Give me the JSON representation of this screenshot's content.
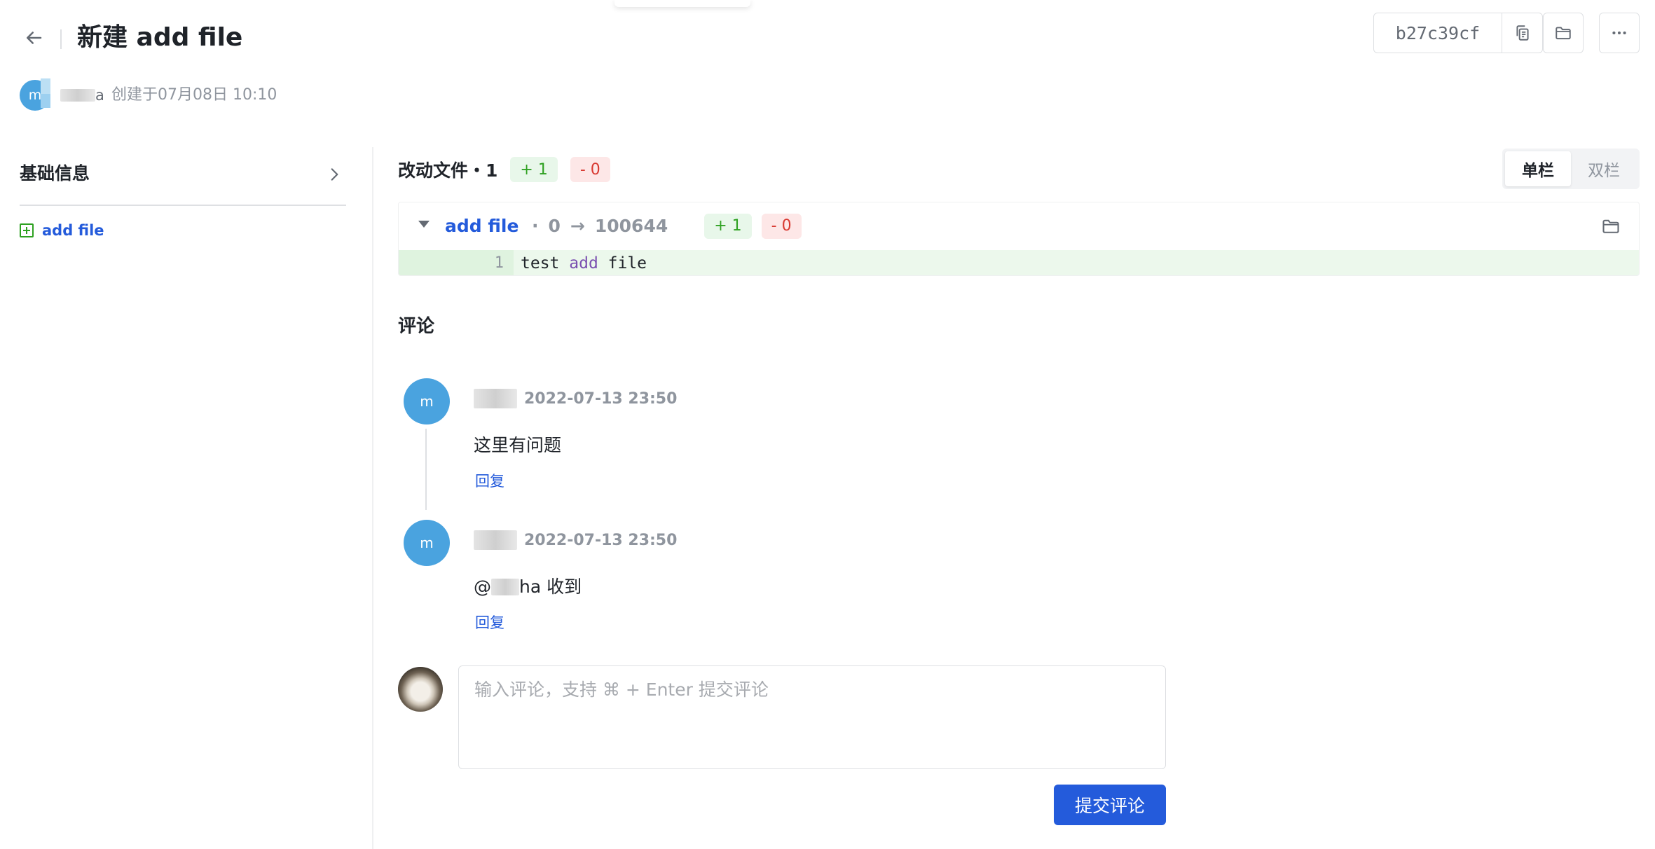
{
  "header": {
    "title": "新建 add file",
    "commit_hash": "b27c39cf",
    "author_name_suffix": "a",
    "created_at": "创建于07月08日 10:10",
    "author_avatar_letter": "m"
  },
  "sidebar": {
    "section_title": "基础信息",
    "files": [
      {
        "name": "add file",
        "status": "added"
      }
    ]
  },
  "changes": {
    "title": "改动文件・1",
    "added": "+ 1",
    "removed": "- 0",
    "view_modes": [
      "单栏",
      "双栏"
    ],
    "active_view": "单栏"
  },
  "diff": {
    "file_name": "add file",
    "sep": "·",
    "old_mode": "0",
    "arrow": "→",
    "new_mode": "100644",
    "added": "+ 1",
    "removed": "- 0",
    "lines": [
      {
        "number": "1",
        "code_a": "test ",
        "code_kw": "add",
        "code_b": " file"
      }
    ]
  },
  "comments": {
    "title": "评论",
    "items": [
      {
        "avatar_letter": "m",
        "time": "2022-07-13 23:50",
        "body": "这里有问题",
        "reply_label": "回复"
      },
      {
        "avatar_letter": "m",
        "time": "2022-07-13 23:50",
        "body_prefix": "@",
        "body_suffix": "ha 收到",
        "reply_label": "回复"
      }
    ],
    "input_placeholder": "输入评论，支持 ⌘ + Enter 提交评论",
    "submit_label": "提交评论"
  },
  "colors": {
    "primary": "#245bdb",
    "add": "#2ea121",
    "remove": "#d83931",
    "avatar": "#4aa3df"
  },
  "icons": [
    "arrow-left-icon",
    "copy-icon",
    "folder-icon",
    "more-icon",
    "chevron-right-icon",
    "file-added-icon",
    "caret-down-icon"
  ]
}
